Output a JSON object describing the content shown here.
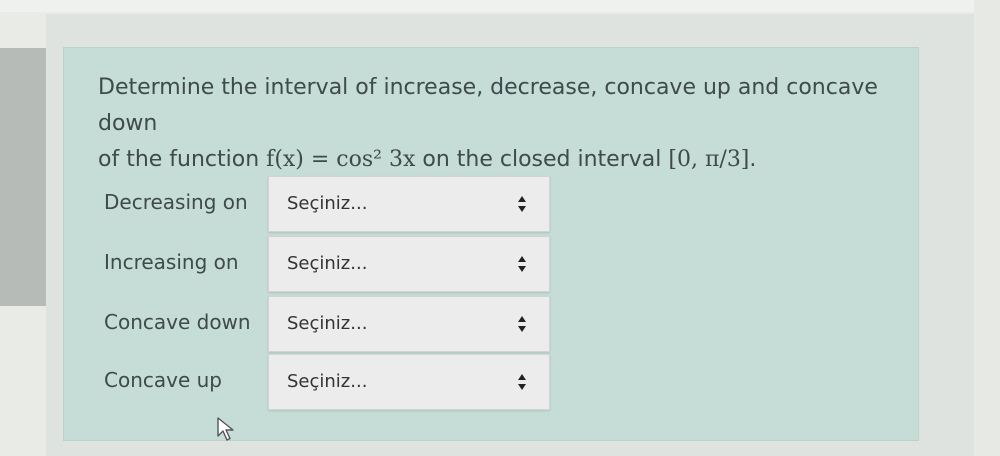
{
  "question": {
    "line1": "Determine the interval of increase, decrease, concave up and concave down",
    "line2_prefix": "of the function ",
    "func": "f(x) = cos² 3x",
    "line2_mid": " on the closed interval ",
    "interval": "[0, π/3]",
    "line2_suffix": "."
  },
  "rows": [
    {
      "label": "Decreasing on",
      "select_value": "Seçiniz..."
    },
    {
      "label": "Increasing on",
      "select_value": "Seçiniz..."
    },
    {
      "label": "Concave down",
      "select_value": "Seçiniz..."
    },
    {
      "label": "Concave up",
      "select_value": "Seçiniz..."
    }
  ],
  "icons": {
    "select_arrow": "up-down-arrow-icon",
    "cursor": "mouse-pointer-icon"
  },
  "colors": {
    "card_background": "#c5ddd6",
    "text": "#3f4a4a",
    "select_background": "#ececec"
  }
}
